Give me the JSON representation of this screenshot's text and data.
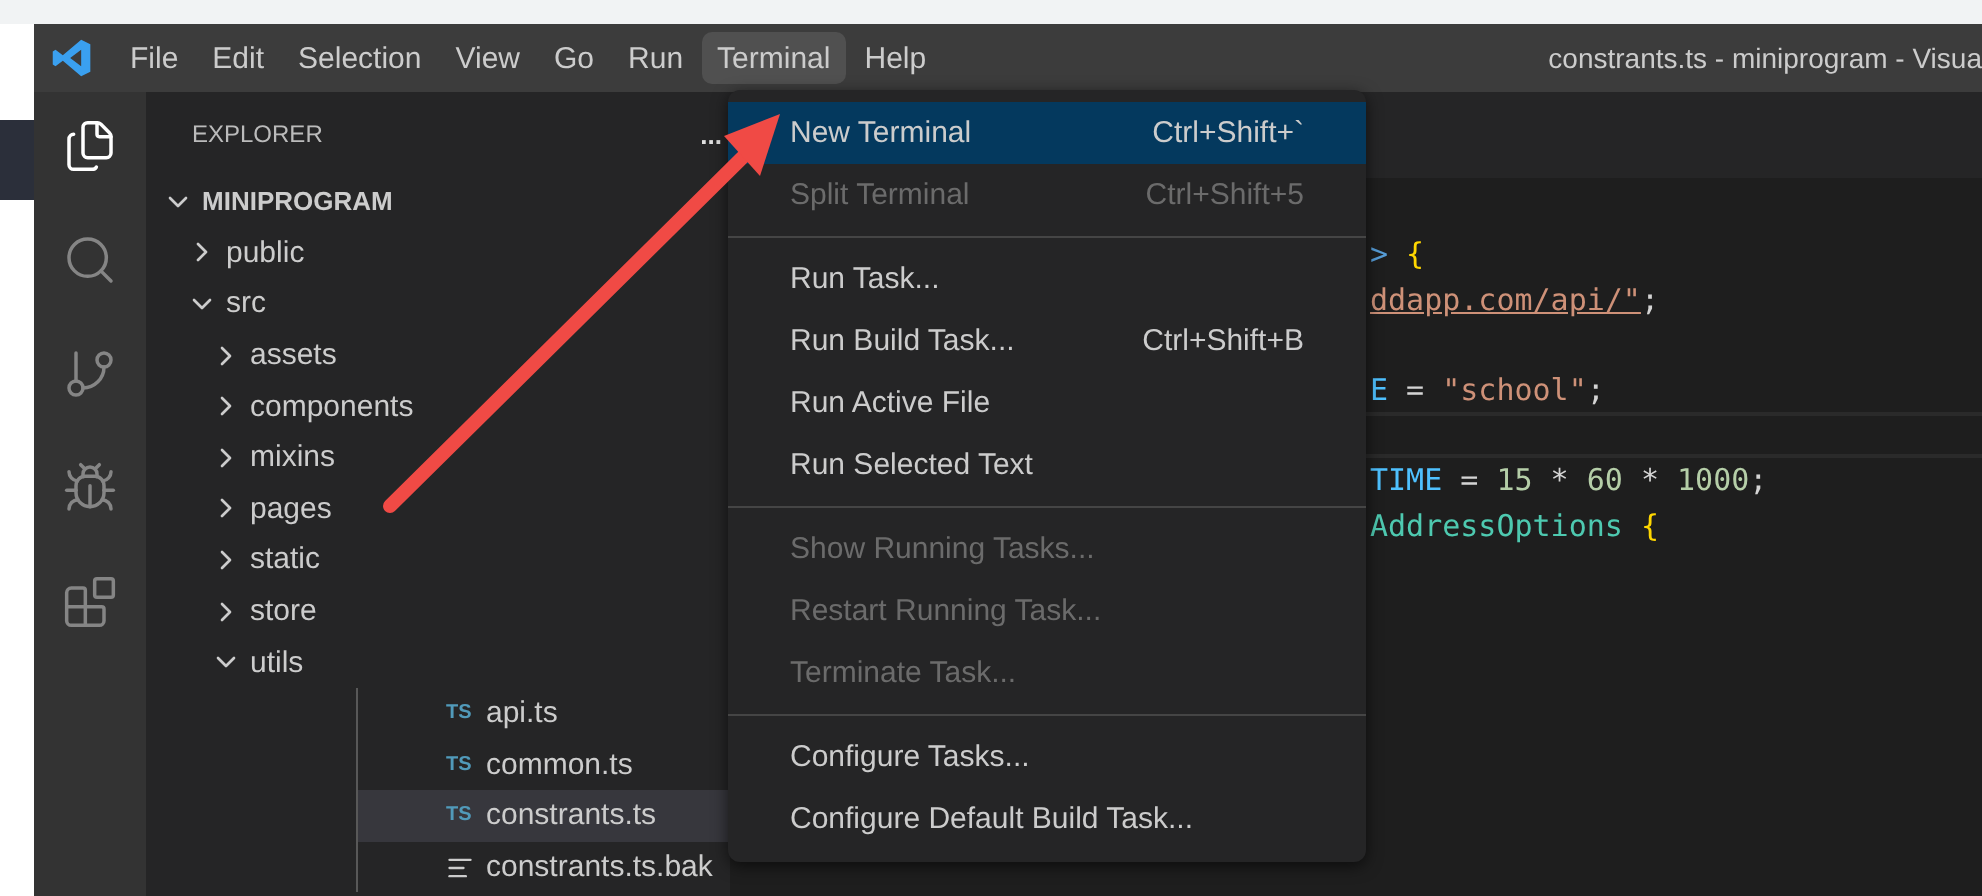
{
  "window": {
    "title": "constrants.ts - miniprogram - Visua"
  },
  "menu_bar": [
    {
      "label": "File",
      "selected": false
    },
    {
      "label": "Edit",
      "selected": false
    },
    {
      "label": "Selection",
      "selected": false
    },
    {
      "label": "View",
      "selected": false
    },
    {
      "label": "Go",
      "selected": false
    },
    {
      "label": "Run",
      "selected": false
    },
    {
      "label": "Terminal",
      "selected": true
    },
    {
      "label": "Help",
      "selected": false
    }
  ],
  "activity_bar": [
    {
      "kind": "explorer",
      "selected": true
    },
    {
      "kind": "search",
      "selected": false
    },
    {
      "kind": "source-control",
      "selected": false
    },
    {
      "kind": "run-debug",
      "selected": false
    },
    {
      "kind": "extensions",
      "selected": false
    }
  ],
  "sidebar": {
    "title": "EXPLORER",
    "more": "...",
    "tree": [
      {
        "label": "MINIPROGRAM",
        "kind": "root",
        "expanded": true,
        "selected": false,
        "children": [
          {
            "label": "public",
            "kind": "folder",
            "expanded": false,
            "selected": false
          },
          {
            "label": "src",
            "kind": "folder",
            "expanded": true,
            "selected": false,
            "children": [
              {
                "label": "assets",
                "kind": "folder",
                "expanded": false,
                "selected": false
              },
              {
                "label": "components",
                "kind": "folder",
                "expanded": false,
                "selected": false
              },
              {
                "label": "mixins",
                "kind": "folder",
                "expanded": false,
                "selected": false
              },
              {
                "label": "pages",
                "kind": "folder",
                "expanded": false,
                "selected": false
              },
              {
                "label": "static",
                "kind": "folder",
                "expanded": false,
                "selected": false
              },
              {
                "label": "store",
                "kind": "folder",
                "expanded": false,
                "selected": false
              },
              {
                "label": "utils",
                "kind": "folder",
                "expanded": true,
                "selected": false,
                "children": [
                  {
                    "label": "api.ts",
                    "kind": "ts",
                    "icon_text": "TS",
                    "selected": false
                  },
                  {
                    "label": "common.ts",
                    "kind": "ts",
                    "icon_text": "TS",
                    "selected": false
                  },
                  {
                    "label": "constrants.ts",
                    "kind": "ts",
                    "icon_text": "TS",
                    "selected": true
                  },
                  {
                    "label": "constrants.ts.bak",
                    "kind": "text",
                    "selected": false
                  }
                ]
              }
            ]
          }
        ]
      }
    ]
  },
  "code_lines": [
    {
      "current": false
    },
    {
      "current": false,
      "tokens": [
        {
          "text": ">",
          "color": "#569cd6"
        },
        {
          "text": " {",
          "color": "#ffd700"
        }
      ]
    },
    {
      "current": false,
      "tokens": [
        {
          "text": "ddapp.com/api/\"",
          "color": "#ce9178"
        },
        {
          "text": ";",
          "color": "#d4d4d4"
        }
      ]
    },
    {
      "current": false
    },
    {
      "current": false,
      "tokens": [
        {
          "text": "E",
          "color": "#4fc1ff"
        },
        {
          "text": " = ",
          "color": "#d4d4d4"
        },
        {
          "text": "\"school\"",
          "color": "#ce9178"
        },
        {
          "text": ";",
          "color": "#d4d4d4"
        }
      ]
    },
    {
      "current": true
    },
    {
      "current": false,
      "tokens": [
        {
          "text": "TIME",
          "color": "#4fc1ff"
        },
        {
          "text": " = ",
          "color": "#d4d4d4"
        },
        {
          "text": "15",
          "color": "#b5cea8"
        },
        {
          "text": " * ",
          "color": "#d4d4d4"
        },
        {
          "text": "60",
          "color": "#b5cea8"
        },
        {
          "text": " * ",
          "color": "#d4d4d4"
        },
        {
          "text": "1000",
          "color": "#b5cea8"
        },
        {
          "text": ";",
          "color": "#d4d4d4"
        }
      ]
    },
    {
      "current": false,
      "tokens": [
        {
          "text": "AddressOptions",
          "color": "#4ec9b0"
        },
        {
          "text": " {",
          "color": "#ffd700"
        }
      ]
    }
  ],
  "terminal_menu": [
    {
      "kind": "item",
      "label": "New Terminal",
      "shortcut": "Ctrl+Shift+`",
      "selected": true,
      "disabled": false
    },
    {
      "kind": "item",
      "label": "Split Terminal",
      "shortcut": "Ctrl+Shift+5",
      "selected": false,
      "disabled": true
    },
    {
      "kind": "separator"
    },
    {
      "kind": "item",
      "label": "Run Task...",
      "selected": false,
      "disabled": false
    },
    {
      "kind": "item",
      "label": "Run Build Task...",
      "shortcut": "Ctrl+Shift+B",
      "selected": false,
      "disabled": false
    },
    {
      "kind": "item",
      "label": "Run Active File",
      "selected": false,
      "disabled": false
    },
    {
      "kind": "item",
      "label": "Run Selected Text",
      "selected": false,
      "disabled": false
    },
    {
      "kind": "separator"
    },
    {
      "kind": "item",
      "label": "Show Running Tasks...",
      "selected": false,
      "disabled": true
    },
    {
      "kind": "item",
      "label": "Restart Running Task...",
      "selected": false,
      "disabled": true
    },
    {
      "kind": "item",
      "label": "Terminate Task...",
      "selected": false,
      "disabled": true
    },
    {
      "kind": "separator"
    },
    {
      "kind": "item",
      "label": "Configure Tasks...",
      "selected": false,
      "disabled": false
    },
    {
      "kind": "item",
      "label": "Configure Default Build Task...",
      "selected": false,
      "disabled": false
    }
  ],
  "annotation": {
    "kind": "arrow"
  }
}
